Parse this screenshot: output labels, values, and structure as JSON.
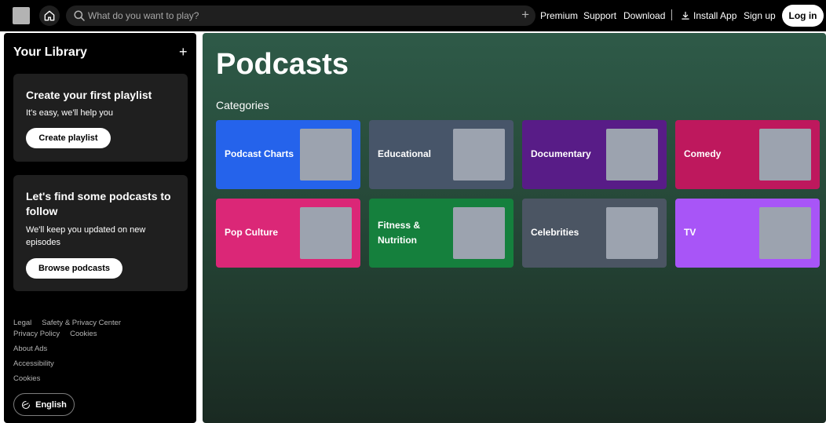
{
  "header": {
    "search_placeholder": "What do you want to play?",
    "nav": [
      "Premium",
      "Support",
      "Download"
    ],
    "install_label": "Install App",
    "signup_label": "Sign up",
    "login_label": "Log in"
  },
  "sidebar": {
    "title": "Your Library",
    "add_icon": "+",
    "cards": [
      {
        "title": "Create your first playlist",
        "subtitle": "It's easy, we'll help you",
        "button": "Create playlist"
      },
      {
        "title": "Let's find some podcasts to follow",
        "subtitle": "We'll keep you updated on new episodes",
        "button": "Browse podcasts"
      }
    ],
    "footer": {
      "row1": [
        "Legal",
        "Safety & Privacy Center"
      ],
      "row2": [
        "Privacy Policy",
        "Cookies"
      ],
      "row3": [
        "About Ads"
      ],
      "row4": [
        "Accessibility"
      ],
      "row5": [
        "Cookies"
      ]
    },
    "language": "English"
  },
  "main": {
    "title": "Podcasts",
    "section": "Categories",
    "tiles": [
      {
        "label": "Podcast Charts",
        "color": "#2563eb"
      },
      {
        "label": "Educational",
        "color": "#475569"
      },
      {
        "label": "Documentary",
        "color": "#581c87"
      },
      {
        "label": "Comedy",
        "color": "#be185d"
      },
      {
        "label": "Pop Culture",
        "color": "#db2777"
      },
      {
        "label": "Fitness & Nutrition",
        "color": "#15803d"
      },
      {
        "label": "Celebrities",
        "color": "#4b5563"
      },
      {
        "label": "TV",
        "color": "#a855f7"
      }
    ]
  },
  "icons": {
    "home": "home-icon",
    "search": "search-icon",
    "download": "download-icon",
    "globe": "globe-icon"
  }
}
